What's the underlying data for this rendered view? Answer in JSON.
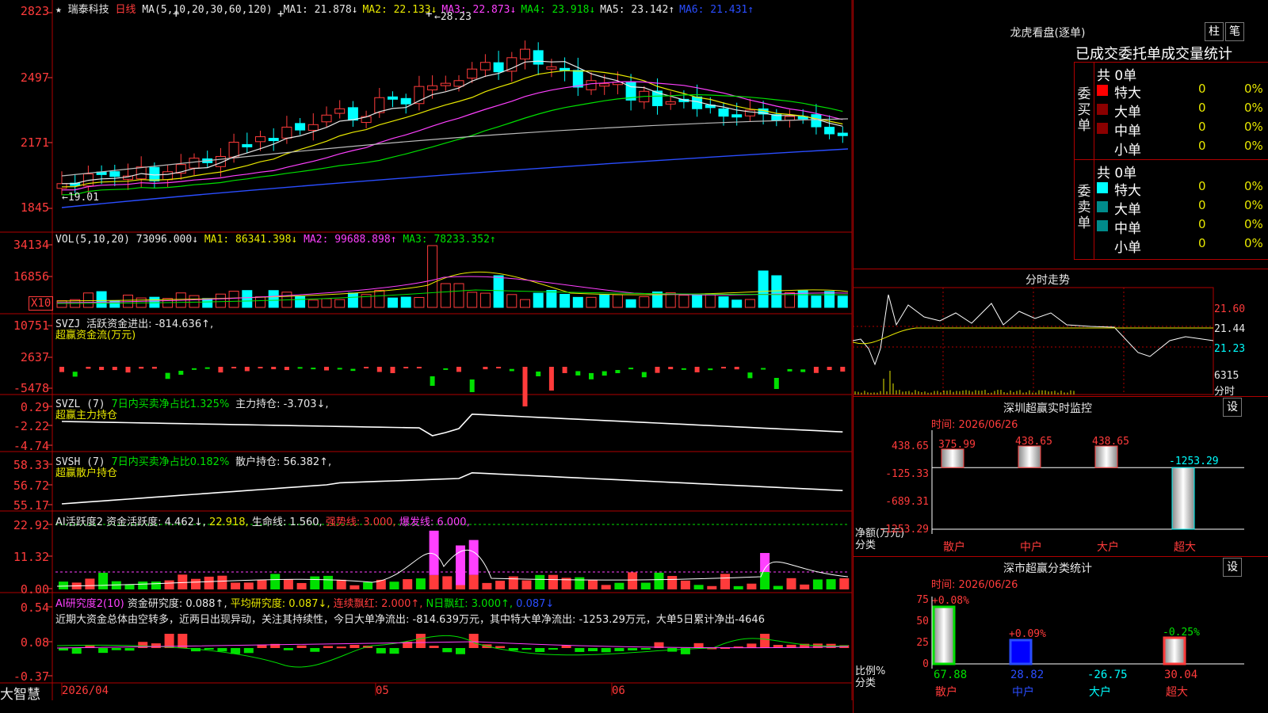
{
  "main": {
    "title_star": "★",
    "stock_name": "瑞泰科技",
    "period": "日线",
    "ma_label": "MA(5,10,20,30,60,120)",
    "ma": [
      {
        "k": "MA1: 21.878↓",
        "c": "#e8e8e8"
      },
      {
        "k": "MA2: 22.133↓",
        "c": "#e8e800"
      },
      {
        "k": "MA3: 22.873↓",
        "c": "#ff40ff"
      },
      {
        "k": "MA4: 23.918↓",
        "c": "#00e000"
      },
      {
        "k": "MA5: 23.142↑",
        "c": "#e8e8e8"
      },
      {
        "k": "MA6: 21.431↑",
        "c": "#2a4dff"
      }
    ],
    "yaxis": [
      "2823",
      "2497",
      "2171",
      "1845"
    ],
    "high_label": "28.23",
    "low_label": "19.01"
  },
  "vol": {
    "label": "VOL(5,10,20)",
    "v": "73096.000↓",
    "ma1": "MA1: 86341.398↓",
    "ma2": "MA2: 99688.898↑",
    "ma3": "MA3: 78233.352↑",
    "yaxis": [
      "34134",
      "16856"
    ],
    "unit": "X10"
  },
  "svzj": {
    "label": "SVZJ",
    "text": "活跃资金进出: -814.636↑,",
    "sub": "超赢资金流(万元)",
    "yaxis": [
      "10751",
      "2637",
      "-5478"
    ]
  },
  "svzl": {
    "label": "SVZL (7)",
    "t1": "7日内买卖净占比1.325%",
    "t2": "主力持仓: -3.703↓,",
    "sub": "超赢主力持仓",
    "yaxis": [
      "0.29",
      "-2.22",
      "-4.74"
    ]
  },
  "svsh": {
    "label": "SVSH (7)",
    "t1": "7日内买卖净占比0.182%",
    "t2": "散户持仓: 56.382↑,",
    "sub": "超赢散户持仓",
    "yaxis": [
      "58.33",
      "56.72",
      "55.17"
    ]
  },
  "ai2": {
    "label": "AI活跃度2",
    "t1": "资金活跃度: 4.462↓,",
    "t2": "22.918,",
    "t3": "生命线: 1.560,",
    "t4": "强势线: 3.000,",
    "t5": "爆发线: 6.000,",
    "yaxis": [
      "22.92",
      "11.32",
      "0.00"
    ]
  },
  "ai_r": {
    "label": "AI研究度2(10)",
    "t1": "资金研究度: 0.088↑,",
    "t2": "平均研究度: 0.087↓,",
    "t3": "连续飘红: 2.000↑,",
    "t4": "N日飘红: 3.000↑,",
    "t5": "0.087↓",
    "comment": "近期大资金总体由空转多，近两日出现异动，关注其持续性，今日大单净流出: -814.639万元，其中特大单净流出: -1253.29万元，大单5日累计净出-4646",
    "yaxis": [
      "0.54",
      "0.08",
      "-0.37"
    ]
  },
  "bottom": {
    "brand": "大智慧",
    "dates": [
      "2026/04",
      "05",
      "06"
    ]
  },
  "right": {
    "lhkp_title": "龙虎看盘(逐单)",
    "btn1": "柱",
    "btn2": "笔",
    "header": "已成交委托单成交量统计",
    "buy_side": "委买单",
    "sell_side": "委卖单",
    "buy_total": "共 0单",
    "sell_total": "共 0单",
    "rows": [
      {
        "name": "特大",
        "v": "0",
        "p": "0%"
      },
      {
        "name": "大单",
        "v": "0",
        "p": "0%"
      },
      {
        "name": "中单",
        "v": "0",
        "p": "0%"
      },
      {
        "name": "小单",
        "v": "0",
        "p": "0%"
      }
    ],
    "fs_title": "分时走势",
    "fs_y": [
      "21.60",
      "21.44",
      "21.23"
    ],
    "fs_vol": "6315",
    "fs_unit": "分时",
    "mon_title": "深圳超赢实时监控",
    "mon_btn": "设",
    "mon_time": "时间: 2026/06/26",
    "mon_y": [
      "438.65",
      "-125.33",
      "-689.31",
      "-1253.29"
    ],
    "mon_vals": [
      "375.99",
      "438.65",
      "438.65",
      "-1253.29"
    ],
    "mon_ylabel": "净额(万元)",
    "mon_xlabel": "分类",
    "cats": [
      "散户",
      "中户",
      "大户",
      "超大"
    ],
    "cls_title": "深市超赢分类统计",
    "cls_btn": "设",
    "cls_time": "时间: 2026/06/26",
    "cls_y": [
      "75",
      "50",
      "25",
      "0"
    ],
    "cls_top": [
      "+0.08%",
      "+0.09%",
      "-0.25%"
    ],
    "cls_vals": [
      "67.88",
      "28.82",
      "-26.75",
      "30.04"
    ],
    "cls_ylabel": "比例%",
    "cls_xlabel": "分类"
  },
  "chart_data": {
    "type": "bar",
    "categories": [
      "散户",
      "中户",
      "大户",
      "超大"
    ],
    "series": [
      {
        "values": [
          375.99,
          438.65,
          438.65,
          -1253.29
        ]
      }
    ],
    "ylim": [
      -1253.29,
      438.65
    ]
  }
}
